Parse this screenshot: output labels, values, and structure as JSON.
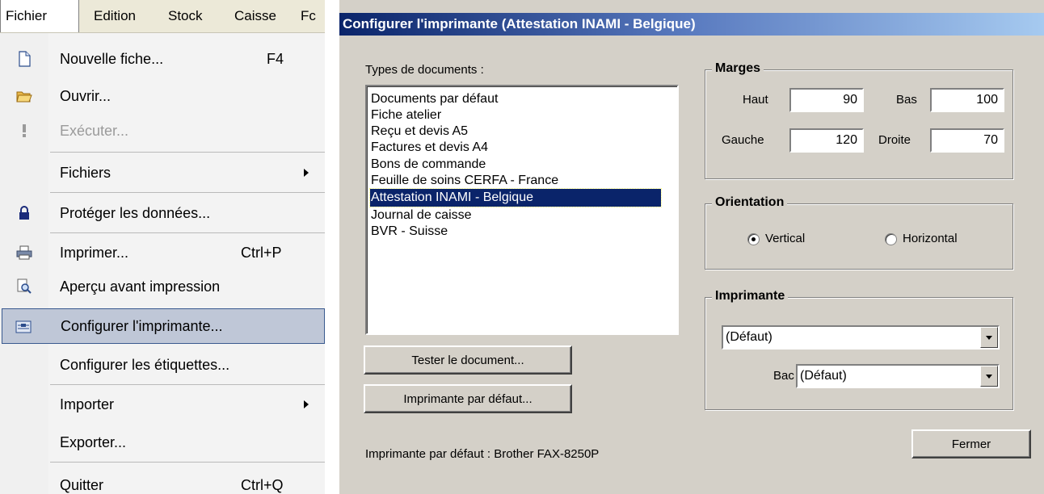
{
  "menubar": {
    "items": [
      "Fichier",
      "Edition",
      "Stock",
      "Caisse",
      "Fc"
    ]
  },
  "menu": {
    "items": [
      {
        "label": "Nouvelle fiche...",
        "shortcut": "F4",
        "icon": "new-document-icon"
      },
      {
        "label": "Ouvrir...",
        "icon": "open-folder-icon"
      },
      {
        "label": "Exécuter...",
        "icon": "exclamation-icon",
        "disabled": true
      },
      {
        "label": "Fichiers",
        "submenu": true
      },
      {
        "label": "Protéger les données...",
        "icon": "lock-icon"
      },
      {
        "label": "Imprimer...",
        "shortcut": "Ctrl+P",
        "icon": "printer-icon"
      },
      {
        "label": "Aperçu avant impression",
        "icon": "print-preview-icon"
      },
      {
        "label": "Configurer l'imprimante...",
        "icon": "printer-setup-icon",
        "highlighted": true
      },
      {
        "label": "Configurer les étiquettes..."
      },
      {
        "label": "Importer",
        "submenu": true
      },
      {
        "label": "Exporter..."
      },
      {
        "label": "Quitter",
        "shortcut": "Ctrl+Q"
      }
    ]
  },
  "dialog": {
    "title": "Configurer l'imprimante (Attestation INAMI - Belgique)",
    "doc_types_label": "Types de documents :",
    "doc_types": [
      "Documents par défaut",
      "Fiche atelier",
      "Reçu et devis A5",
      "Factures et devis A4",
      "Bons de commande",
      "Feuille de soins CERFA - France",
      "Attestation INAMI - Belgique",
      "Journal de caisse",
      "BVR - Suisse"
    ],
    "selected_doc_type": "Attestation INAMI - Belgique",
    "test_button": "Tester le document...",
    "default_printer_button": "Imprimante par défaut...",
    "default_printer_status": "Imprimante par défaut : Brother FAX-8250P",
    "margins": {
      "legend": "Marges",
      "top_label": "Haut",
      "top_value": "90",
      "bottom_label": "Bas",
      "bottom_value": "100",
      "left_label": "Gauche",
      "left_value": "120",
      "right_label": "Droite",
      "right_value": "70"
    },
    "orientation": {
      "legend": "Orientation",
      "vertical": "Vertical",
      "horizontal": "Horizontal",
      "selected": "Vertical"
    },
    "printer": {
      "legend": "Imprimante",
      "printer_value": "(Défaut)",
      "tray_label": "Bac",
      "tray_value": "(Défaut)"
    },
    "close_button": "Fermer"
  }
}
